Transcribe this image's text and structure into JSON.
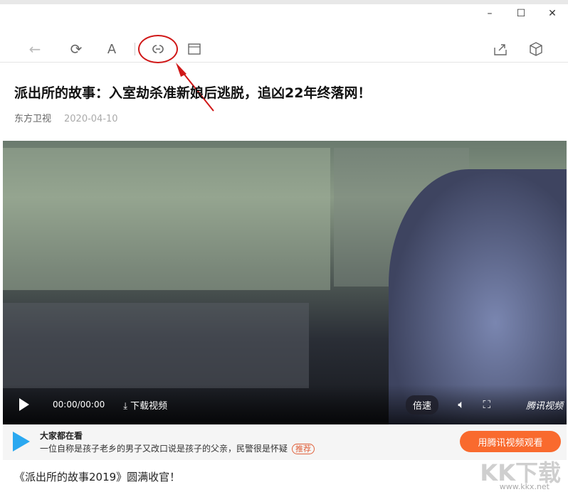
{
  "window": {
    "minimize": "–",
    "maximize": "☐",
    "close": "✕"
  },
  "toolbar": {
    "back": "←",
    "refresh": "⟳",
    "font": "A",
    "link": "🔗",
    "reader": "▭",
    "share": "⇪",
    "box": "⬡"
  },
  "article": {
    "title": "派出所的故事：入室劫杀准新娘后逃脱，追凶22年终落网！",
    "source": "东方卫视",
    "date": "2020-04-10",
    "body": "《派出所的故事2019》圆满收官！"
  },
  "player": {
    "time": "00:00/00:00",
    "download": "下载视频",
    "speed": "倍速",
    "brand": "腾讯视频"
  },
  "recommend": {
    "title": "大家都在看",
    "desc": "一位自称是孩子老乡的男子又改口说是孩子的父亲，民警很是怀疑",
    "badge": "推荐",
    "button": "用腾讯视频观看"
  },
  "watermark": {
    "logo": "KK下载",
    "url": "www.kkx.net"
  },
  "colors": {
    "accent": "#f96a2e",
    "annotation": "#d01818"
  }
}
